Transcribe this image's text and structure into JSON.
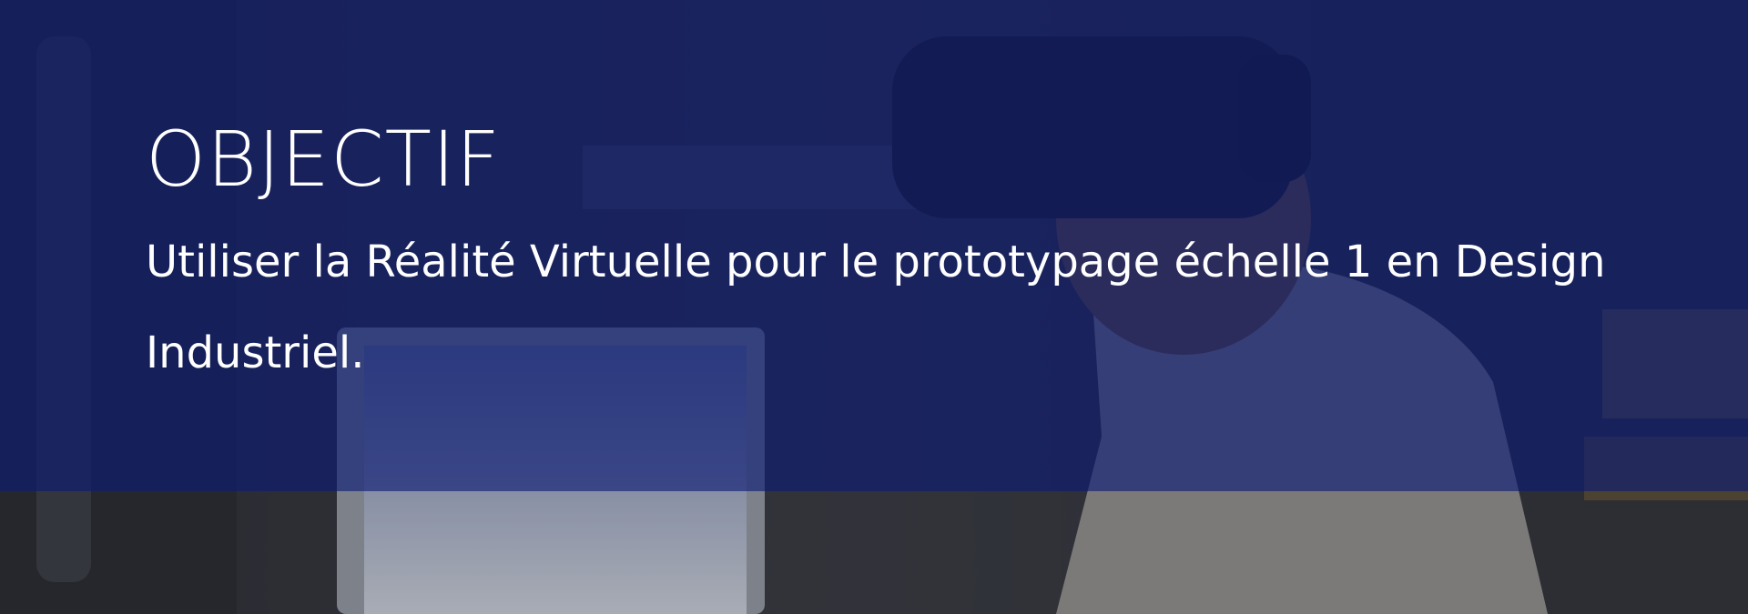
{
  "hero": {
    "title": "OBJECTIF",
    "subtitle": "Utiliser la Réalité Virtuelle pour le prototypage échelle 1 en Design Industriel.",
    "background_image": "person-wearing-vr-headset-in-workshop",
    "overlay_color": "#1e2a8a"
  }
}
